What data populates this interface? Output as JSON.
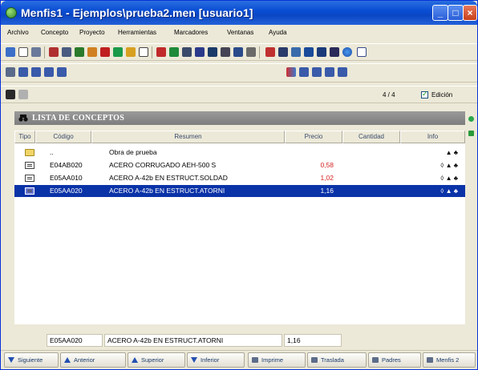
{
  "window": {
    "title": "Menfis1 - Ejemplos\\prueba2.men   [usuario1]",
    "controls": {
      "minimize": "_",
      "maximize": "□",
      "close": "×"
    }
  },
  "menu": [
    "Archivo",
    "Concepto",
    "Proyecto",
    "Herramientas",
    "Marcadores",
    "Ventanas",
    "Ayuda"
  ],
  "nav_bar": {
    "position": "4 / 4",
    "edit_label": "Edición",
    "edit_checked": true
  },
  "panel": {
    "title": "LISTA DE CONCEPTOS",
    "columns": [
      "Tipo",
      "Código",
      "Resumen",
      "Precio",
      "Cantidad",
      "Info"
    ]
  },
  "rows": [
    {
      "type_icon": "folder-icon",
      "code": "..",
      "summary": "Obra de prueba",
      "price": "",
      "qty": "",
      "info": "▲ ♣",
      "price_color": ""
    },
    {
      "type_icon": "document-icon",
      "code": "E04AB020",
      "summary": "ACERO CORRUGADO AEH-500 S",
      "price": "0,58",
      "qty": "",
      "info": "◊ ▲ ♣",
      "price_color": "#d42424"
    },
    {
      "type_icon": "document-icon",
      "code": "E05AA010",
      "summary": "ACERO A-42b EN ESTRUCT.SOLDAD",
      "price": "1,02",
      "qty": "",
      "info": "◊ ▲ ♣",
      "price_color": "#d42424"
    },
    {
      "type_icon": "document-icon",
      "code": "E05AA020",
      "summary": "ACERO A-42b EN ESTRUCT.ATORNI",
      "price": "1,16",
      "qty": "",
      "info": "◊ ▲ ♣",
      "price_color": "",
      "selected": true
    }
  ],
  "status": {
    "code": "E05AA020",
    "summary": "ACERO A-42b EN ESTRUCT.ATORNI",
    "price": "1,16"
  },
  "bottom_buttons": [
    {
      "label": "Siguiente",
      "icon": "arrow-down-icon"
    },
    {
      "label": "Anterior",
      "icon": "arrow-up-icon"
    },
    {
      "label": "Superior",
      "icon": "arrow-up-icon"
    },
    {
      "label": "Inferior",
      "icon": "arrow-down-icon"
    },
    {
      "label": "Imprime",
      "icon": "printer-icon"
    },
    {
      "label": "Traslada",
      "icon": "move-icon"
    },
    {
      "label": "Padres",
      "icon": "tree-icon"
    },
    {
      "label": "Menfis 2",
      "icon": "window-icon"
    }
  ],
  "colors": {
    "title_bar": "#0a4ed4",
    "selection": "#0a33a8",
    "price_red": "#d42424",
    "panel_header": "#8a8a8a"
  }
}
